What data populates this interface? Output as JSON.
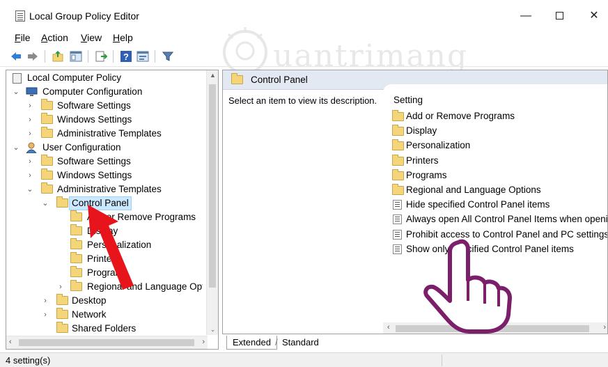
{
  "window": {
    "title": "Local Group Policy Editor",
    "minimize_glyph": "—",
    "close_glyph": "✕"
  },
  "menu": {
    "file": {
      "key": "F",
      "rest": "ile"
    },
    "action": {
      "key": "A",
      "rest": "ction"
    },
    "view": {
      "key": "V",
      "rest": "iew"
    },
    "help": {
      "key": "H",
      "rest": "elp"
    }
  },
  "toolbar": {
    "icons": [
      "back-icon",
      "forward-icon",
      "up-folder-icon",
      "show-hide-tree-icon",
      "export-list-icon",
      "help-icon",
      "properties-icon",
      "filter-icon"
    ]
  },
  "watermark": {
    "text": "uantrimang"
  },
  "tree": {
    "root": "Local Computer Policy",
    "computer_config": "Computer Configuration",
    "cc_software": "Software Settings",
    "cc_windows": "Windows Settings",
    "cc_admin": "Administrative Templates",
    "user_config": "User Configuration",
    "uc_software": "Software Settings",
    "uc_windows": "Windows Settings",
    "uc_admin": "Administrative Templates",
    "control_panel": "Control Panel",
    "cp_add_remove": "Add or Remove Programs",
    "cp_display": "Display",
    "cp_personalization": "Personalization",
    "cp_printers": "Printers",
    "cp_programs": "Programs",
    "cp_regional": "Regional and Language Options",
    "desktop": "Desktop",
    "network": "Network",
    "shared_folders": "Shared Folders"
  },
  "right_pane": {
    "header_title": "Control Panel",
    "description": "Select an item to view its description.",
    "column_header": "Setting",
    "items": [
      {
        "type": "folder",
        "label": "Add or Remove Programs"
      },
      {
        "type": "folder",
        "label": "Display"
      },
      {
        "type": "folder",
        "label": "Personalization"
      },
      {
        "type": "folder",
        "label": "Printers"
      },
      {
        "type": "folder",
        "label": "Programs"
      },
      {
        "type": "folder",
        "label": "Regional and Language Options"
      },
      {
        "type": "setting",
        "label": "Hide specified Control Panel items"
      },
      {
        "type": "setting",
        "label": "Always open All Control Panel Items when openin"
      },
      {
        "type": "setting",
        "label": "Prohibit access to Control Panel and PC settings"
      },
      {
        "type": "setting",
        "label": "Show only specified Control Panel items"
      }
    ]
  },
  "tabs": {
    "extended": "Extended",
    "standard": "Standard"
  },
  "status": {
    "text": "4 setting(s)"
  },
  "colors": {
    "selection_bg": "#cce8ff",
    "header_bg": "#e3e9f2",
    "folder": "#f5d57a",
    "red_arrow": "#e8141b",
    "hand_outline": "#7b1f6a"
  }
}
